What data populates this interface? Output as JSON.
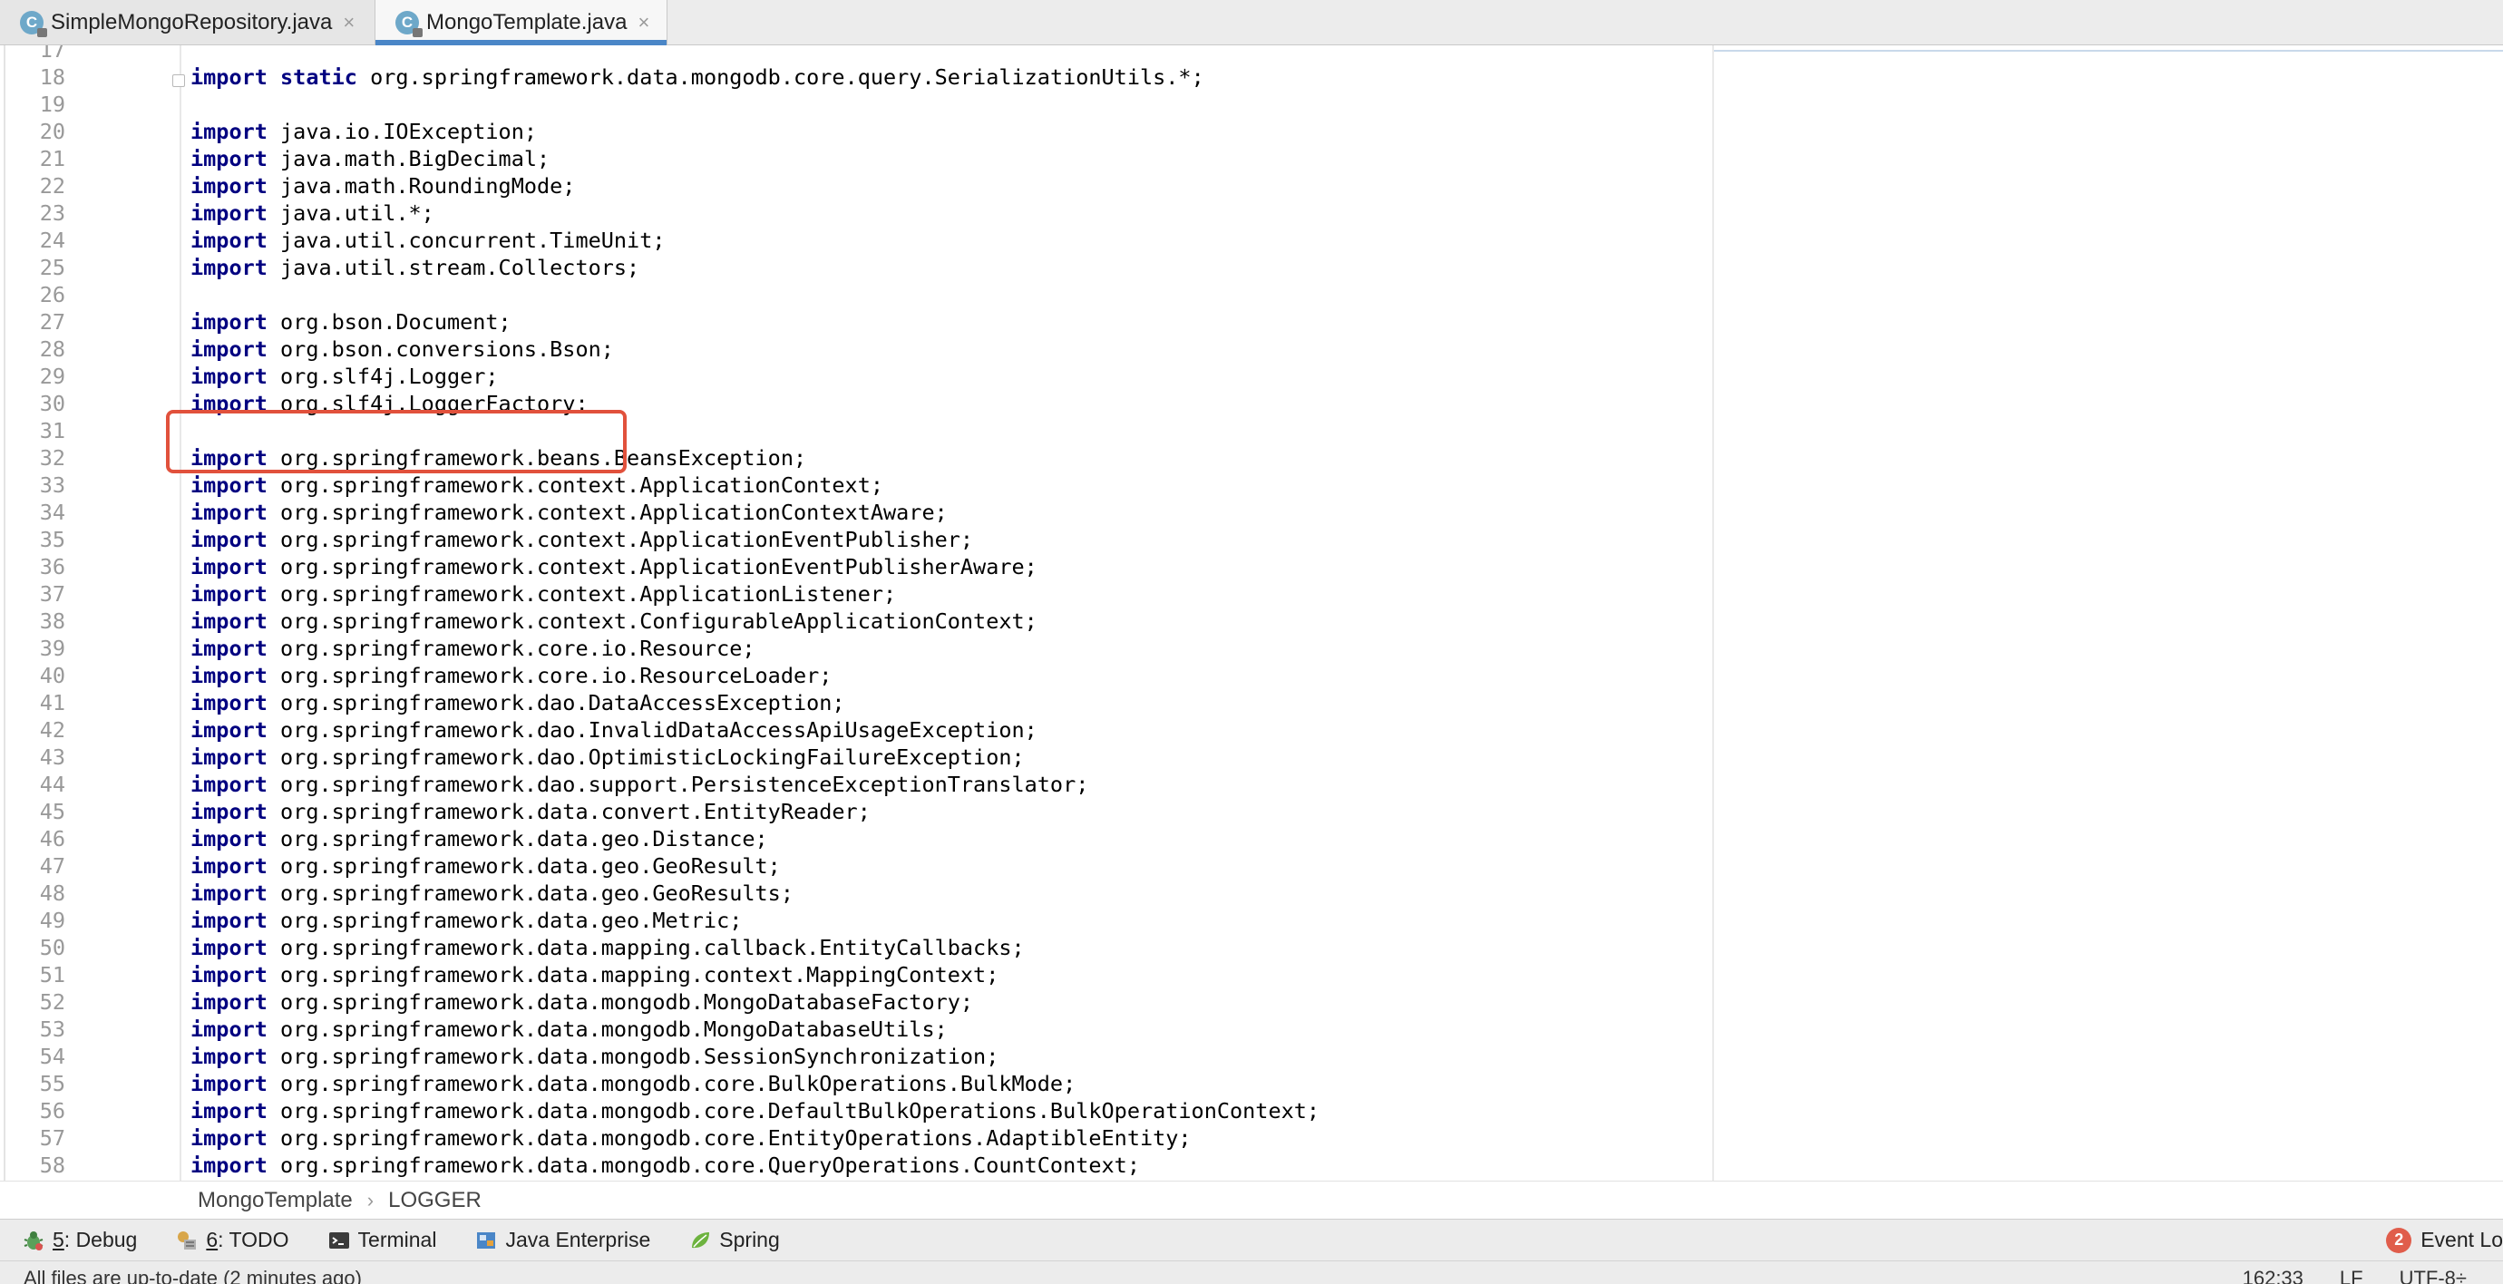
{
  "tabs": [
    {
      "label": "SimpleMongoRepository.java",
      "icon": "java-class-icon",
      "active": false
    },
    {
      "label": "MongoTemplate.java",
      "icon": "java-class-icon",
      "active": true
    }
  ],
  "file_icon_letter": "C",
  "close_glyph": "×",
  "editor": {
    "lines": [
      {
        "num": "17",
        "kw": "",
        "rest": ""
      },
      {
        "num": "18",
        "kw": "import static",
        "rest": " org.springframework.data.mongodb.core.query.SerializationUtils.*;"
      },
      {
        "num": "19",
        "kw": "",
        "rest": ""
      },
      {
        "num": "20",
        "kw": "import",
        "rest": " java.io.IOException;"
      },
      {
        "num": "21",
        "kw": "import",
        "rest": " java.math.BigDecimal;"
      },
      {
        "num": "22",
        "kw": "import",
        "rest": " java.math.RoundingMode;"
      },
      {
        "num": "23",
        "kw": "import",
        "rest": " java.util.*;"
      },
      {
        "num": "24",
        "kw": "import",
        "rest": " java.util.concurrent.TimeUnit;"
      },
      {
        "num": "25",
        "kw": "import",
        "rest": " java.util.stream.Collectors;"
      },
      {
        "num": "26",
        "kw": "",
        "rest": ""
      },
      {
        "num": "27",
        "kw": "import",
        "rest": " org.bson.Document;"
      },
      {
        "num": "28",
        "kw": "import",
        "rest": " org.bson.conversions.Bson;"
      },
      {
        "num": "29",
        "kw": "import",
        "rest": " org.slf4j.Logger;"
      },
      {
        "num": "30",
        "kw": "import",
        "rest": " org.slf4j.LoggerFactory;"
      },
      {
        "num": "31",
        "kw": "",
        "rest": ""
      },
      {
        "num": "32",
        "kw": "import",
        "rest": " org.springframework.beans.BeansException;"
      },
      {
        "num": "33",
        "kw": "import",
        "rest": " org.springframework.context.ApplicationContext;"
      },
      {
        "num": "34",
        "kw": "import",
        "rest": " org.springframework.context.ApplicationContextAware;"
      },
      {
        "num": "35",
        "kw": "import",
        "rest": " org.springframework.context.ApplicationEventPublisher;"
      },
      {
        "num": "36",
        "kw": "import",
        "rest": " org.springframework.context.ApplicationEventPublisherAware;"
      },
      {
        "num": "37",
        "kw": "import",
        "rest": " org.springframework.context.ApplicationListener;"
      },
      {
        "num": "38",
        "kw": "import",
        "rest": " org.springframework.context.ConfigurableApplicationContext;"
      },
      {
        "num": "39",
        "kw": "import",
        "rest": " org.springframework.core.io.Resource;"
      },
      {
        "num": "40",
        "kw": "import",
        "rest": " org.springframework.core.io.ResourceLoader;"
      },
      {
        "num": "41",
        "kw": "import",
        "rest": " org.springframework.dao.DataAccessException;"
      },
      {
        "num": "42",
        "kw": "import",
        "rest": " org.springframework.dao.InvalidDataAccessApiUsageException;"
      },
      {
        "num": "43",
        "kw": "import",
        "rest": " org.springframework.dao.OptimisticLockingFailureException;"
      },
      {
        "num": "44",
        "kw": "import",
        "rest": " org.springframework.dao.support.PersistenceExceptionTranslator;"
      },
      {
        "num": "45",
        "kw": "import",
        "rest": " org.springframework.data.convert.EntityReader;"
      },
      {
        "num": "46",
        "kw": "import",
        "rest": " org.springframework.data.geo.Distance;"
      },
      {
        "num": "47",
        "kw": "import",
        "rest": " org.springframework.data.geo.GeoResult;"
      },
      {
        "num": "48",
        "kw": "import",
        "rest": " org.springframework.data.geo.GeoResults;"
      },
      {
        "num": "49",
        "kw": "import",
        "rest": " org.springframework.data.geo.Metric;"
      },
      {
        "num": "50",
        "kw": "import",
        "rest": " org.springframework.data.mapping.callback.EntityCallbacks;"
      },
      {
        "num": "51",
        "kw": "import",
        "rest": " org.springframework.data.mapping.context.MappingContext;"
      },
      {
        "num": "52",
        "kw": "import",
        "rest": " org.springframework.data.mongodb.MongoDatabaseFactory;"
      },
      {
        "num": "53",
        "kw": "import",
        "rest": " org.springframework.data.mongodb.MongoDatabaseUtils;"
      },
      {
        "num": "54",
        "kw": "import",
        "rest": " org.springframework.data.mongodb.SessionSynchronization;"
      },
      {
        "num": "55",
        "kw": "import",
        "rest": " org.springframework.data.mongodb.core.BulkOperations.BulkMode;"
      },
      {
        "num": "56",
        "kw": "import",
        "rest": " org.springframework.data.mongodb.core.DefaultBulkOperations.BulkOperationContext;"
      },
      {
        "num": "57",
        "kw": "import",
        "rest": " org.springframework.data.mongodb.core.EntityOperations.AdaptibleEntity;"
      },
      {
        "num": "58",
        "kw": "import",
        "rest": " org.springframework.data.mongodb.core.QueryOperations.CountContext;"
      }
    ]
  },
  "breadcrumb": [
    "MongoTemplate",
    "LOGGER"
  ],
  "breadcrumb_separator": "›",
  "tool_windows": [
    {
      "key": "5",
      "label": ": Debug",
      "icon": "debug-bug-icon"
    },
    {
      "key": "6",
      "label": ": TODO",
      "icon": "todo-icon"
    },
    {
      "key": "",
      "label": "Terminal",
      "icon": "terminal-icon"
    },
    {
      "key": "",
      "label": "Java Enterprise",
      "icon": "java-enterprise-icon"
    },
    {
      "key": "",
      "label": "Spring",
      "icon": "spring-leaf-icon"
    }
  ],
  "event_log": {
    "count": "2",
    "label": "Event Lo"
  },
  "status": {
    "message": "All files are up-to-date (2 minutes ago)",
    "position": "162:33",
    "line_separator": "LF",
    "encoding": "UTF-8÷"
  },
  "colors": {
    "keyword": "#000080",
    "highlight_box": "#e1513c",
    "active_tab_underline": "#4a86c7",
    "line_number": "#999999"
  }
}
